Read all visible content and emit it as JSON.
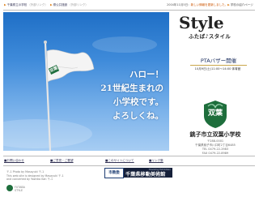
{
  "topbar": {
    "link1": "千葉県立の学校",
    "link1_tag": "（外部リンク）",
    "link2": "県公共施設",
    "link2_tag": "（外部リンク）",
    "news": "2004年11月5日：",
    "news_highlight": "新しい情報を更新しました。",
    "news_tail": "学校の紹介ページ"
  },
  "hero": {
    "flag_text": "双葉",
    "slogan": [
      "ハロー！",
      "21世紀生まれの",
      "小学校です。",
      "よろしくね。"
    ]
  },
  "side": {
    "style_title": "Style",
    "style_sub": "ふたば♪スタイル",
    "pta_title": "PTAバザー開催",
    "pta_date": "10月9日(土)11:00～14:00 体育館",
    "logo_text": "双葉",
    "school_name": "銚子市立双葉小学校",
    "address": [
      "〒288-0001",
      "千葉県銚子市川口町2丁目6485",
      "TEL 0479-22-2983",
      "FAX 0479-22-8989"
    ]
  },
  "bottom_links": {
    "a": "■お問い合わせ",
    "b": "■ご意見・ご要望",
    "c": "■このサイトについて",
    "d": "■リンク集"
  },
  "banners": {
    "a": "市教委",
    "b_small": "Traveling Exhibition",
    "b_big": "千葉県移動美術館"
  },
  "credits": [
    "〒-1 Photo by Masayuki 〒-1",
    "This web site is designed by Masayuki 〒-1",
    "and converted by Yoshiko Kan 〒-1"
  ],
  "footer": {
    "line1": "FUTABA",
    "line2": "STYLE"
  },
  "colors": {
    "accent": "#e08a2a",
    "green": "#1e6e3c",
    "sky": "#3f8bda"
  }
}
